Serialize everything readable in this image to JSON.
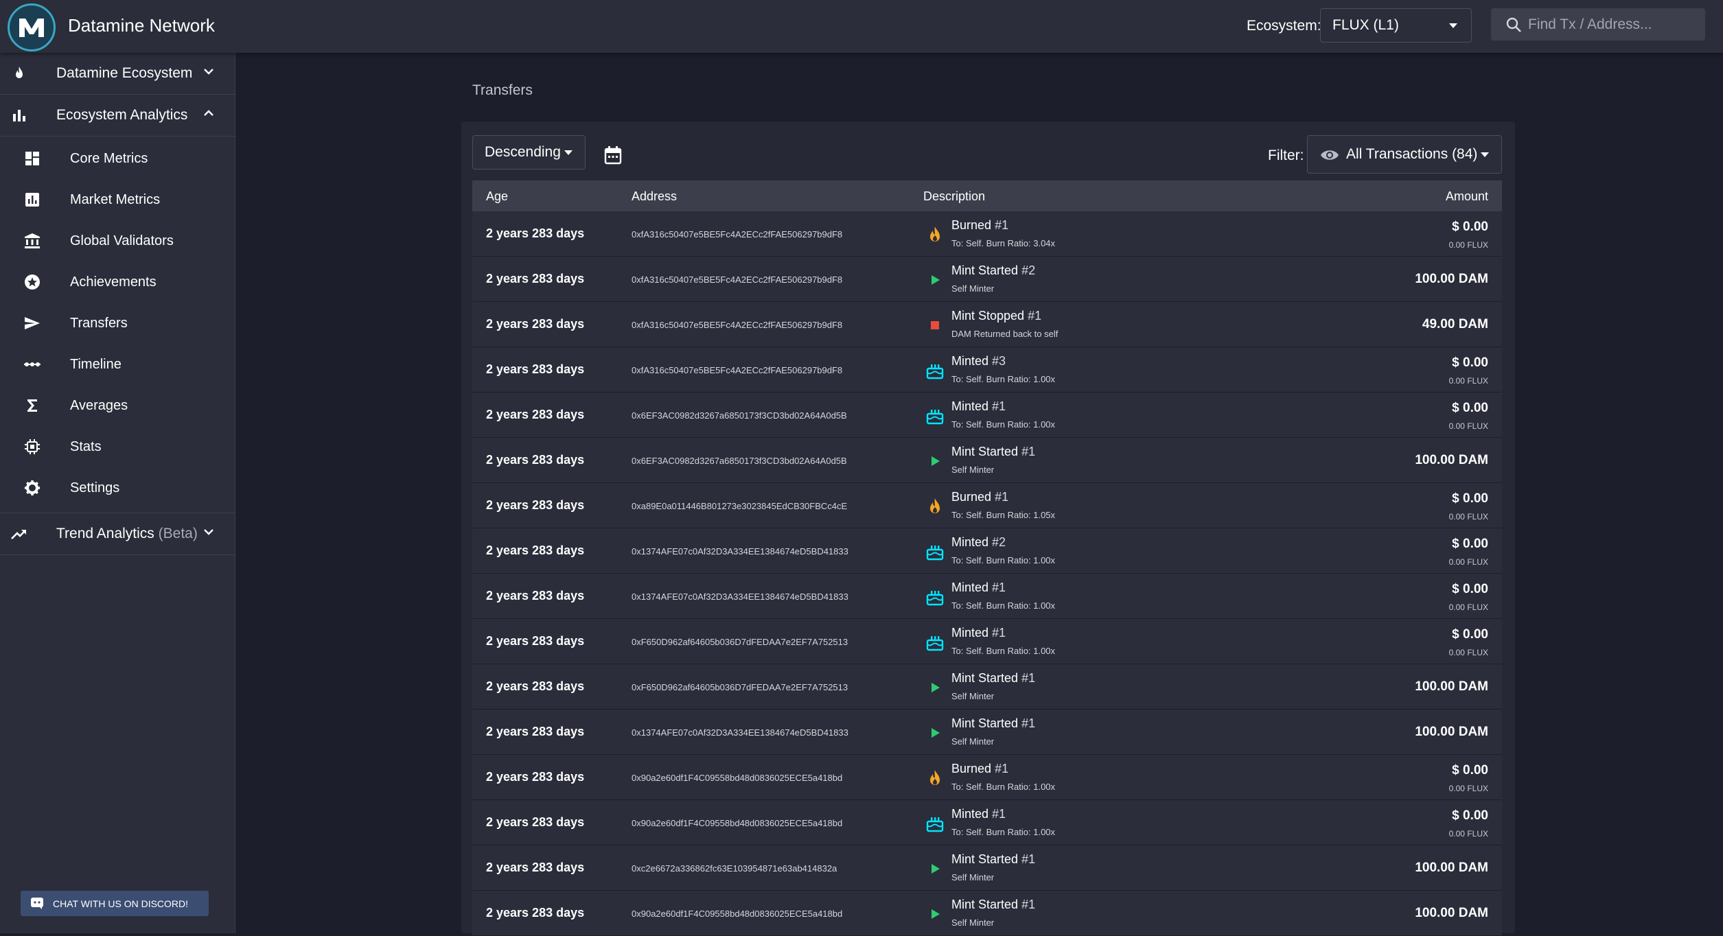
{
  "header": {
    "app_title": "Datamine Network",
    "ecosystem_label": "Ecosystem:",
    "ecosystem_value": "FLUX (L1)",
    "search_placeholder": "Find Tx / Address..."
  },
  "sidebar": {
    "groups": {
      "ecosystem": "Datamine Ecosystem",
      "analytics": "Ecosystem Analytics",
      "trend": "Trend Analytics",
      "trend_badge": "(Beta)"
    },
    "items": [
      {
        "label": "Core Metrics",
        "icon": "dashboard-icon"
      },
      {
        "label": "Market Metrics",
        "icon": "bar-chart-icon"
      },
      {
        "label": "Global Validators",
        "icon": "bank-icon"
      },
      {
        "label": "Achievements",
        "icon": "star-icon"
      },
      {
        "label": "Transfers",
        "icon": "send-icon"
      },
      {
        "label": "Timeline",
        "icon": "timeline-icon"
      },
      {
        "label": "Averages",
        "icon": "sigma-icon"
      },
      {
        "label": "Stats",
        "icon": "chip-icon"
      },
      {
        "label": "Settings",
        "icon": "gear-icon"
      }
    ],
    "discord_label": "CHAT WITH US ON DISCORD!"
  },
  "main": {
    "heading": "Transfers",
    "sort_value": "Descending",
    "filter_label": "Filter:",
    "filter_value": "All Transactions (84)",
    "columns": {
      "age": "Age",
      "address": "Address",
      "description": "Description",
      "amount": "Amount"
    },
    "colors": {
      "burn": "#f5a623",
      "mint_started": "#2ecc71",
      "mint_stopped": "#e74c3c",
      "minted": "#00e5ff"
    },
    "rows": [
      {
        "age": "2 years 283 days",
        "address": "0xfA316c50407e5BE5Fc4A2ECc2fFAE506297b9dF8",
        "type": "burn",
        "title": "Burned",
        "num": "#1",
        "sub": "To: Self. Burn Ratio: 3.04x",
        "amount": "$ 0.00",
        "amount_sub": "0.00 FLUX"
      },
      {
        "age": "2 years 283 days",
        "address": "0xfA316c50407e5BE5Fc4A2ECc2fFAE506297b9dF8",
        "type": "mint_started",
        "title": "Mint Started",
        "num": "#2",
        "sub": "Self Minter",
        "amount": "100.00 DAM",
        "amount_sub": ""
      },
      {
        "age": "2 years 283 days",
        "address": "0xfA316c50407e5BE5Fc4A2ECc2fFAE506297b9dF8",
        "type": "mint_stopped",
        "title": "Mint Stopped",
        "num": "#1",
        "sub": "DAM Returned back to self",
        "amount": "49.00 DAM",
        "amount_sub": ""
      },
      {
        "age": "2 years 283 days",
        "address": "0xfA316c50407e5BE5Fc4A2ECc2fFAE506297b9dF8",
        "type": "minted",
        "title": "Minted",
        "num": "#3",
        "sub": "To: Self. Burn Ratio: 1.00x",
        "amount": "$ 0.00",
        "amount_sub": "0.00 FLUX"
      },
      {
        "age": "2 years 283 days",
        "address": "0x6EF3AC0982d3267a6850173f3CD3bd02A64A0d5B",
        "type": "minted",
        "title": "Minted",
        "num": "#1",
        "sub": "To: Self. Burn Ratio: 1.00x",
        "amount": "$ 0.00",
        "amount_sub": "0.00 FLUX"
      },
      {
        "age": "2 years 283 days",
        "address": "0x6EF3AC0982d3267a6850173f3CD3bd02A64A0d5B",
        "type": "mint_started",
        "title": "Mint Started",
        "num": "#1",
        "sub": "Self Minter",
        "amount": "100.00 DAM",
        "amount_sub": ""
      },
      {
        "age": "2 years 283 days",
        "address": "0xa89E0a011446B801273e3023845EdCB30FBCc4cE",
        "type": "burn",
        "title": "Burned",
        "num": "#1",
        "sub": "To: Self. Burn Ratio: 1.05x",
        "amount": "$ 0.00",
        "amount_sub": "0.00 FLUX"
      },
      {
        "age": "2 years 283 days",
        "address": "0x1374AFE07c0Af32D3A334EE1384674eD5BD41833",
        "type": "minted",
        "title": "Minted",
        "num": "#2",
        "sub": "To: Self. Burn Ratio: 1.00x",
        "amount": "$ 0.00",
        "amount_sub": "0.00 FLUX"
      },
      {
        "age": "2 years 283 days",
        "address": "0x1374AFE07c0Af32D3A334EE1384674eD5BD41833",
        "type": "minted",
        "title": "Minted",
        "num": "#1",
        "sub": "To: Self. Burn Ratio: 1.00x",
        "amount": "$ 0.00",
        "amount_sub": "0.00 FLUX"
      },
      {
        "age": "2 years 283 days",
        "address": "0xF650D962af64605b036D7dFEDAA7e2EF7A752513",
        "type": "minted",
        "title": "Minted",
        "num": "#1",
        "sub": "To: Self. Burn Ratio: 1.00x",
        "amount": "$ 0.00",
        "amount_sub": "0.00 FLUX"
      },
      {
        "age": "2 years 283 days",
        "address": "0xF650D962af64605b036D7dFEDAA7e2EF7A752513",
        "type": "mint_started",
        "title": "Mint Started",
        "num": "#1",
        "sub": "Self Minter",
        "amount": "100.00 DAM",
        "amount_sub": ""
      },
      {
        "age": "2 years 283 days",
        "address": "0x1374AFE07c0Af32D3A334EE1384674eD5BD41833",
        "type": "mint_started",
        "title": "Mint Started",
        "num": "#1",
        "sub": "Self Minter",
        "amount": "100.00 DAM",
        "amount_sub": ""
      },
      {
        "age": "2 years 283 days",
        "address": "0x90a2e60df1F4C09558bd48d0836025ECE5a418bd",
        "type": "burn",
        "title": "Burned",
        "num": "#1",
        "sub": "To: Self. Burn Ratio: 1.00x",
        "amount": "$ 0.00",
        "amount_sub": "0.00 FLUX"
      },
      {
        "age": "2 years 283 days",
        "address": "0x90a2e60df1F4C09558bd48d0836025ECE5a418bd",
        "type": "minted",
        "title": "Minted",
        "num": "#1",
        "sub": "To: Self. Burn Ratio: 1.00x",
        "amount": "$ 0.00",
        "amount_sub": "0.00 FLUX"
      },
      {
        "age": "2 years 283 days",
        "address": "0xc2e6672a336862fc63E103954871e63ab414832a",
        "type": "mint_started",
        "title": "Mint Started",
        "num": "#1",
        "sub": "Self Minter",
        "amount": "100.00 DAM",
        "amount_sub": ""
      },
      {
        "age": "2 years 283 days",
        "address": "0x90a2e60df1F4C09558bd48d0836025ECE5a418bd",
        "type": "mint_started",
        "title": "Mint Started",
        "num": "#1",
        "sub": "Self Minter",
        "amount": "100.00 DAM",
        "amount_sub": ""
      }
    ]
  }
}
